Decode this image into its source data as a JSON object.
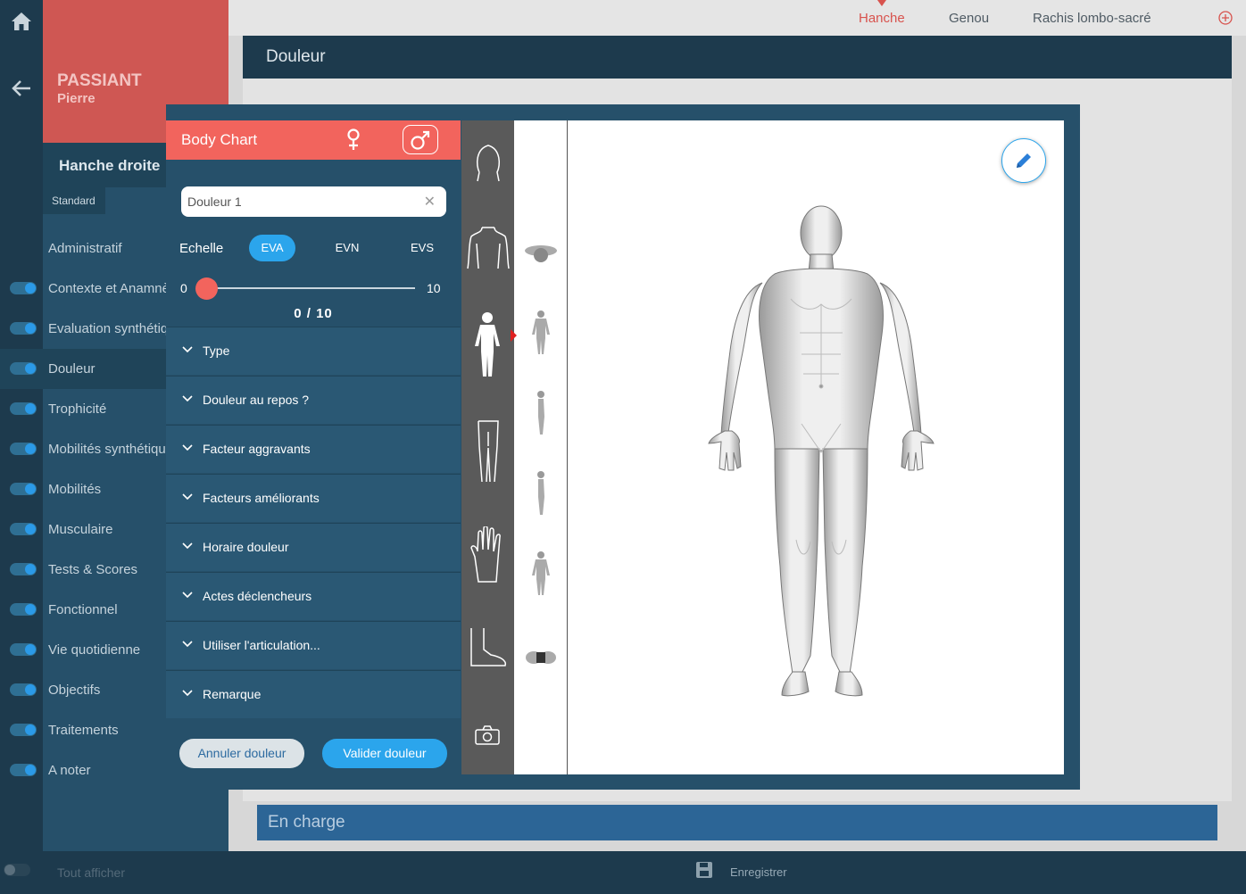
{
  "patient": {
    "last_name": "PASSIANT",
    "first_name": "Pierre"
  },
  "section": {
    "title": "Hanche droite",
    "tab": "Standard"
  },
  "nav": {
    "items": [
      {
        "label": "Administratif",
        "toggle": false,
        "active": false
      },
      {
        "label": "Contexte et Anamnèse",
        "toggle": true,
        "active": false
      },
      {
        "label": "Evaluation synthétique",
        "toggle": true,
        "active": false
      },
      {
        "label": "Douleur",
        "toggle": true,
        "active": true
      },
      {
        "label": "Trophicité",
        "toggle": true,
        "active": false
      },
      {
        "label": "Mobilités synthétiques",
        "toggle": true,
        "active": false
      },
      {
        "label": "Mobilités",
        "toggle": true,
        "active": false
      },
      {
        "label": "Musculaire",
        "toggle": true,
        "active": false
      },
      {
        "label": "Tests & Scores",
        "toggle": true,
        "active": false
      },
      {
        "label": "Fonctionnel",
        "toggle": true,
        "active": false
      },
      {
        "label": "Vie quotidienne",
        "toggle": true,
        "active": false
      },
      {
        "label": "Objectifs",
        "toggle": true,
        "active": false
      },
      {
        "label": "Traitements",
        "toggle": true,
        "active": false
      },
      {
        "label": "A noter",
        "toggle": true,
        "active": false
      }
    ],
    "show_all": "Tout afficher"
  },
  "top_tabs": [
    {
      "label": "Hanche",
      "active": true
    },
    {
      "label": "Genou",
      "active": false
    },
    {
      "label": "Rachis lombo-sacré",
      "active": false
    }
  ],
  "page": {
    "section_title": "Douleur",
    "en_charge": "En charge",
    "save": "Enregistrer"
  },
  "body_chart": {
    "title": "Body Chart",
    "pain_name": "Douleur 1",
    "scale_label": "Echelle",
    "scales": [
      "EVA",
      "EVN",
      "EVS"
    ],
    "active_scale": "EVA",
    "slider": {
      "min": "0",
      "max": "10",
      "value": 0,
      "display": "0 / 10"
    },
    "sections": [
      "Type",
      "Douleur au repos ?",
      "Facteur aggravants",
      "Facteurs améliorants",
      "Horaire douleur",
      "Actes déclencheurs",
      "Utiliser l'articulation...",
      "Remarque"
    ],
    "cancel": "Annuler douleur",
    "validate": "Valider douleur"
  },
  "colors": {
    "accent": "#2ba5ec",
    "coral": "#f2645d",
    "navy": "#1d3a4d",
    "panel": "#26506a"
  }
}
